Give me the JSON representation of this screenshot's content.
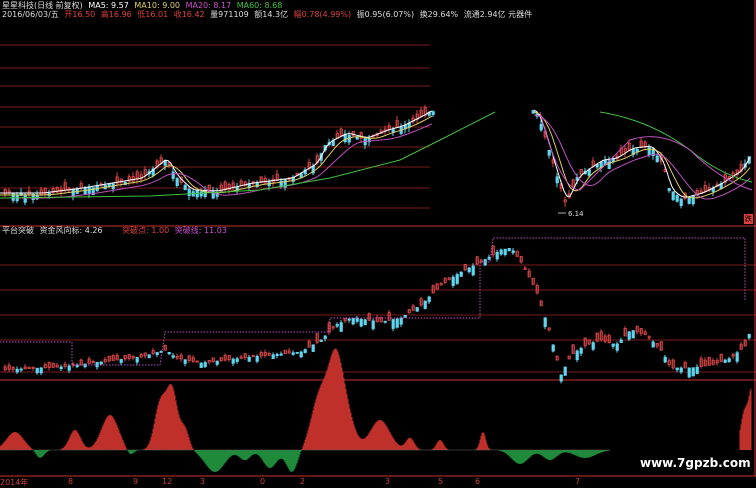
{
  "header": {
    "stock_title": "星星科技(日线 前复权)",
    "ma5_label": "MA5: 9.57",
    "ma10_label": "MA10: 9.00",
    "ma20_label": "MA20: 8.17",
    "ma60_label": "MA60: 8.68",
    "date": "2016/06/03/五",
    "open": "开16.50",
    "high": "高16.96",
    "low": "低16.01",
    "close": "收16.42",
    "volume": "量971109",
    "amount": "额14.3亿",
    "change": "幅0.78(4.99%)",
    "amplitude": "振0.95(6.07%)",
    "turnover": "换29.64%",
    "float": "流通2.94亿 元器件"
  },
  "main_chart": {
    "low_label": "6.14",
    "right_marker": "跌"
  },
  "sub_indicator": {
    "title": "平台突破",
    "fund_label": "资金风向标: 4.26",
    "breakout_point": "突破点: 1.00",
    "breakout_line": "突破线: 11.03"
  },
  "x_axis": {
    "labels": [
      "2014年",
      "8",
      "9",
      "12",
      "3",
      "0",
      "2",
      "3",
      "5",
      "6",
      "7"
    ]
  },
  "watermark": "www.7gpzb.com",
  "colors": {
    "up": "#d94545",
    "down": "#5fd6f0",
    "ma5": "#ffffff",
    "ma10": "#e0d060",
    "ma20": "#c050c0",
    "ma60": "#40c040",
    "grid": "#7a1c1c",
    "axis": "#c83030"
  }
}
